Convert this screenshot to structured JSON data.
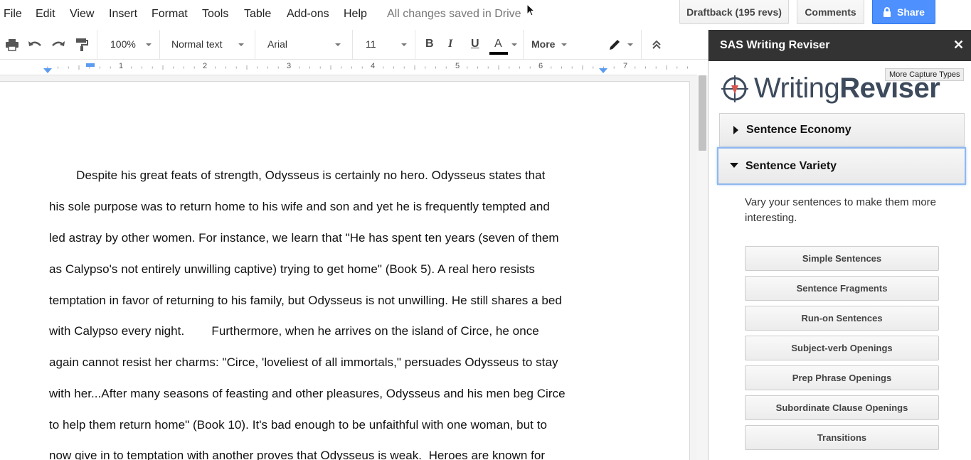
{
  "menu": {
    "items": [
      "File",
      "Edit",
      "View",
      "Insert",
      "Format",
      "Tools",
      "Table",
      "Add-ons",
      "Help"
    ],
    "save_status": "All changes saved in Drive"
  },
  "header_buttons": {
    "draftback": "Draftback (195 revs)",
    "comments": "Comments",
    "share": "Share"
  },
  "toolbar": {
    "zoom": "100%",
    "style": "Normal text",
    "font": "Arial",
    "size": "11",
    "bold": "B",
    "italic": "I",
    "underline": "U",
    "text_color": "A",
    "more": "More"
  },
  "ruler": {
    "numbers": [
      "1",
      "2",
      "3",
      "4",
      "5",
      "6",
      "7"
    ]
  },
  "document": {
    "lines": [
      "        Despite his great feats of strength, Odysseus is certainly no hero. Odysseus states that",
      "his sole purpose was to return home to his wife and son and yet he is frequently tempted and",
      "led astray by other women. For instance, we learn that \"He has spent ten years (seven of them",
      "as Calypso's not entirely unwilling captive) trying to get home\" (Book 5). A real hero resists",
      "temptation in favor of returning to his family, but Odysseus is not unwilling. He still shares a bed",
      "with Calypso every night.        Furthermore, when he arrives on the island of Circe, he once",
      "again cannot resist her charms: \"Circe, 'loveliest of all immortals,\" persuades Odysseus to stay",
      "with her...After many seasons of feasting and other pleasures, Odysseus and his men beg Circe",
      "to help them return home\" (Book 10). It's bad enough to be unfaithful with one woman, but to",
      "now give in to temptation with another proves that Odysseus is weak.  Heroes are known for"
    ]
  },
  "sidebar": {
    "title": "SAS Writing Reviser",
    "close": "✕",
    "logo_light": "Writing",
    "logo_bold": "Reviser",
    "tooltip": "More Capture Types",
    "sections": [
      {
        "label": "Sentence Economy",
        "expanded": false
      },
      {
        "label": "Sentence Variety",
        "expanded": true
      }
    ],
    "description": "Vary your sentences to make them more interesting.",
    "buttons": [
      "Simple Sentences",
      "Sentence Fragments",
      "Run-on Sentences",
      "Subject-verb Openings",
      "Prep Phrase Openings",
      "Subordinate Clause Openings",
      "Transitions"
    ]
  },
  "colors": {
    "share_blue": "#4d90fe",
    "sidebar_header": "#333333",
    "active_border": "#8fb8f0"
  }
}
